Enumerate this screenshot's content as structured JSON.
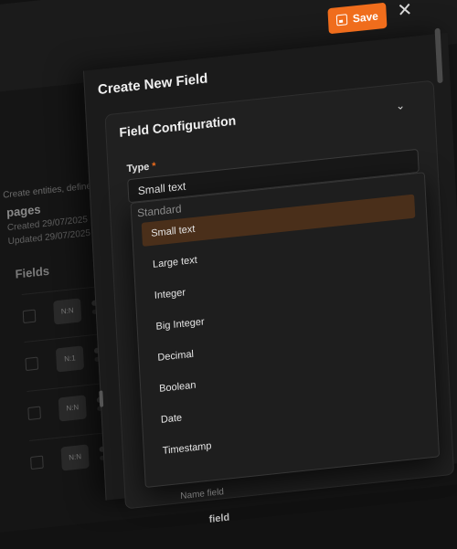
{
  "background": {
    "description_text": "e. Create entities, define",
    "collection": {
      "title": "pages",
      "created": "Created 29/07/2025",
      "updated": "Updated 29/07/2025"
    },
    "fields_heading": "Fields",
    "rows": [
      {
        "chip": "N:N"
      },
      {
        "chip": "N:1"
      },
      {
        "chip": "N:N"
      },
      {
        "chip": "N:N"
      }
    ]
  },
  "panel": {
    "title": "Create New Field",
    "save_label": "Save",
    "close_glyph": "✕",
    "config": {
      "title": "Field Configuration",
      "collapse_glyph": "⌄",
      "type_label": "Type",
      "required_mark": "*",
      "selected_value": "Small text",
      "group_label": "Standard",
      "options": [
        "Small text",
        "Large text",
        "Integer",
        "Big Integer",
        "Decimal",
        "Boolean",
        "Date",
        "Timestamp"
      ],
      "selected_index": 0
    },
    "below_hint": "Name field",
    "below_label": "field"
  },
  "colors": {
    "accent": "#f06d1c",
    "selected_bg": "#4a2f1a",
    "panel_bg": "#1b1b1b"
  }
}
